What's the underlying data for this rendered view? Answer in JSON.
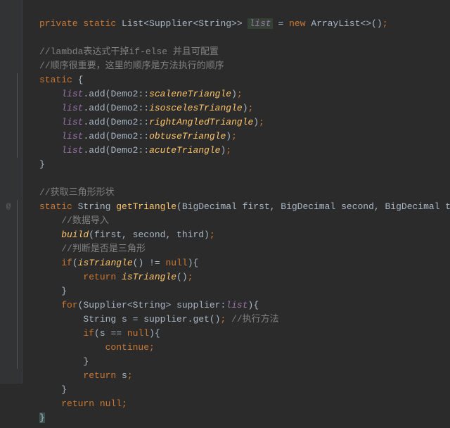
{
  "code": {
    "line1": {
      "kw1": "private static ",
      "type": "List<Supplier<String>> ",
      "field": "list",
      "assign": " = ",
      "kw2": "new ",
      "ctor": "ArrayList<>()",
      "semi": ";"
    },
    "c1": "//lambda表达式干掉if-else 并且可配置",
    "c2": "//顺序很重要，这里的顺序是方法执行的顺序",
    "static_kw": "static ",
    "brace_open": "{",
    "brace_close": "}",
    "add": {
      "prefix_field": "list",
      "call": ".add(Demo2::",
      "m1": "scaleneTriangle",
      "m2": "isoscelesTriangle",
      "m3": "rightAngledTriangle",
      "m4": "obtuseTriangle",
      "m5": "acuteTriangle",
      "close": ")",
      "semi": ";"
    },
    "c3": "//获取三角形形状",
    "getTriangle": {
      "kw": "static ",
      "ret": "String ",
      "name": "getTriangle",
      "params": "(BigDecimal first, BigDecimal second, BigDecimal third)",
      "brace": "{"
    },
    "c4": "//数据导入",
    "build": {
      "name": "build",
      "args": "(first, second, third)",
      "semi": ";"
    },
    "c5": "//判断是否是三角形",
    "if1": {
      "kw": "if",
      "open": "(",
      "call": "isTriangle",
      "paren": "()",
      "op": " != ",
      "null": "null",
      "close": ")",
      "brace": "{"
    },
    "ret1": {
      "kw": "return ",
      "call": "isTriangle",
      "paren": "()",
      "semi": ";"
    },
    "for1": {
      "kw": "for",
      "open": "(",
      "type": "Supplier<String> ",
      "var": "supplier",
      "colon": ":",
      "field": "list",
      "close": ")",
      "brace": "{"
    },
    "assign1": {
      "type": "String ",
      "var": "s",
      "eq": " = ",
      "call": "supplier.get()",
      "semi": ";",
      "comment": " //执行方法"
    },
    "if2": {
      "kw": "if",
      "open": "(",
      "var": "s",
      "op": " == ",
      "null": "null",
      "close": ")",
      "brace": "{"
    },
    "cont": {
      "kw": "continue",
      "semi": ";"
    },
    "ret2": {
      "kw": "return ",
      "var": "s",
      "semi": ";"
    },
    "ret3": {
      "kw": "return ",
      "null": "null",
      "semi": ";"
    }
  },
  "gutter": {
    "at": "@"
  }
}
